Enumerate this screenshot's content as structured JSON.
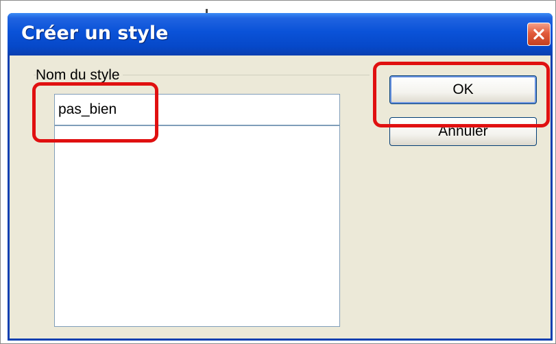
{
  "dialog": {
    "title": "Créer un style",
    "close_icon": "close-icon",
    "group_label": "Nom du style",
    "style_name_value": "pas_bien",
    "ok_label": "OK",
    "cancel_label": "Annuler"
  },
  "colors": {
    "title_bar": "#0a52d8",
    "dialog_bg": "#ece9d8",
    "highlight": "#e01010",
    "close_button": "#e25b3c"
  }
}
